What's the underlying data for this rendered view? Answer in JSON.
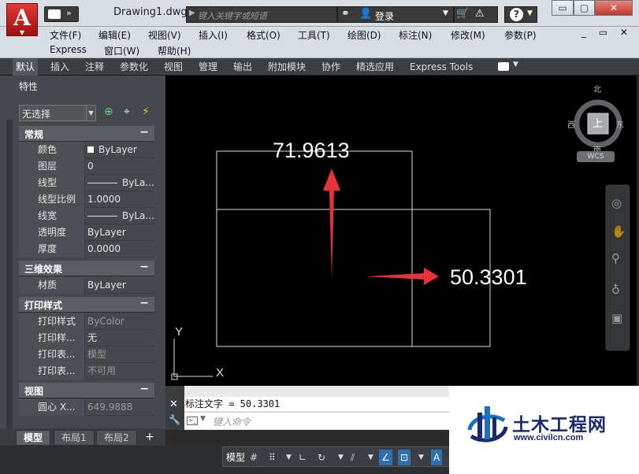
{
  "titlebar": {
    "app_logo": "A",
    "document_title": "Drawing1.dwg",
    "search_placeholder": "键入关键字或短语",
    "login_label": "登录",
    "minimize_label": "▭",
    "maximize_label": "▢",
    "close_label": "✕"
  },
  "menubar": {
    "items": [
      "文件(F)",
      "编辑(E)",
      "视图(V)",
      "插入(I)",
      "格式(O)",
      "工具(T)",
      "绘图(D)",
      "标注(N)",
      "修改(M)",
      "参数(P)",
      "Express",
      "窗口(W)",
      "帮助(H)"
    ],
    "doc_controls": "_ ▭ ✕"
  },
  "ribbon": {
    "tabs": [
      "默认",
      "插入",
      "注释",
      "参数化",
      "视图",
      "管理",
      "输出",
      "附加模块",
      "协作",
      "精选应用",
      "Express Tools"
    ],
    "active_tab": "默认"
  },
  "properties": {
    "title": "特性",
    "selection": "无选择",
    "sections": [
      {
        "label": "常规",
        "toggle": "−",
        "rows": [
          {
            "name": "颜色",
            "value": "ByLayer"
          },
          {
            "name": "图层",
            "value": "0"
          },
          {
            "name": "线型",
            "value": "ByLa..."
          },
          {
            "name": "线型比例",
            "value": "1.0000"
          },
          {
            "name": "线宽",
            "value": "ByLa..."
          },
          {
            "name": "透明度",
            "value": "ByLayer"
          },
          {
            "name": "厚度",
            "value": "0.0000"
          }
        ]
      },
      {
        "label": "三维效果",
        "toggle": "−",
        "rows": [
          {
            "name": "材质",
            "value": "ByLayer"
          }
        ]
      },
      {
        "label": "打印样式",
        "toggle": "−",
        "rows": [
          {
            "name": "打印样式",
            "value": "ByColor"
          },
          {
            "name": "打印样...",
            "value": "无"
          },
          {
            "name": "打印表...",
            "value": "模型"
          },
          {
            "name": "打印表...",
            "value": "不可用"
          }
        ]
      },
      {
        "label": "视图",
        "toggle": "−",
        "rows": [
          {
            "name": "圆心 X...",
            "value": "649.9888"
          }
        ]
      }
    ]
  },
  "layout_tabs": [
    "模型",
    "布局1",
    "布局2"
  ],
  "drawing": {
    "dim_vertical": "71.9613",
    "dim_horizontal": "50.3301",
    "ucs_x": "X",
    "ucs_y": "Y",
    "arrow_color": "#e8323a"
  },
  "viewcube": {
    "north": "北",
    "south": "南",
    "east": "东",
    "west": "西",
    "face": "上",
    "wcs": "WCS"
  },
  "command": {
    "history": "标注文字 = 50.3301",
    "placeholder": "键入命令"
  },
  "statusbar": {
    "model": "模型"
  },
  "watermark": {
    "title": "土木工程网",
    "url": "www.civilcn.com"
  }
}
